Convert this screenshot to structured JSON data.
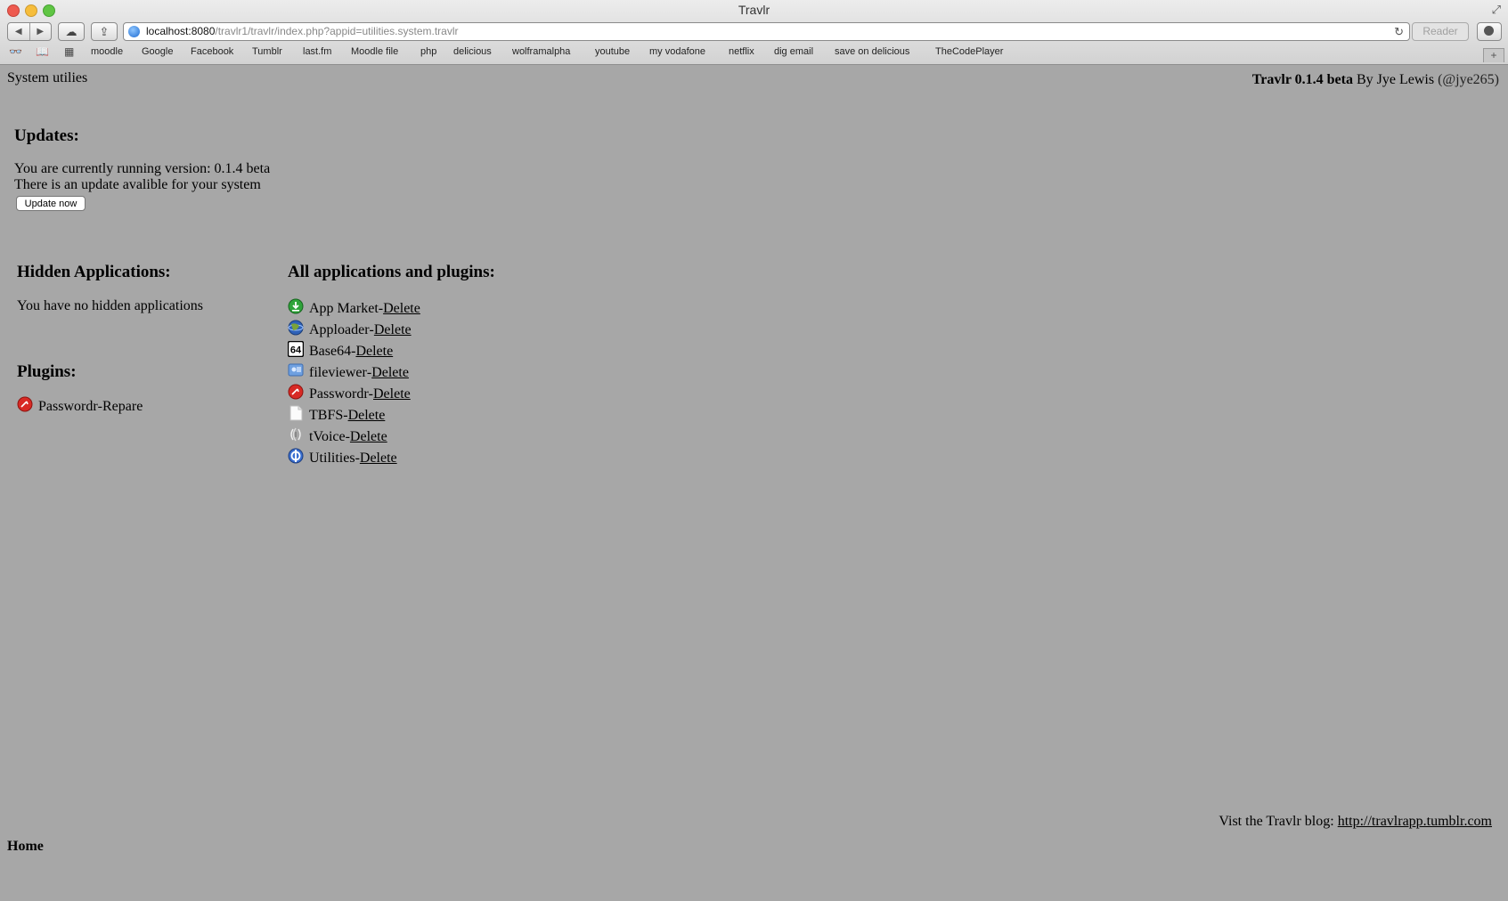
{
  "browser": {
    "window_title": "Travlr",
    "url_host": "localhost:8080",
    "url_path": "/travlr1/travlr/index.php?appid=utilities.system.travlr",
    "reader_label": "Reader",
    "bookmarks": [
      "moodle",
      "Google",
      "Facebook",
      "Tumblr",
      "last.fm",
      "Moodle file",
      "php",
      "delicious",
      "wolframalpha",
      "youtube",
      "my vodafone",
      "netflix",
      "dig email",
      "save on delicious",
      "TheCodePlayer"
    ]
  },
  "header": {
    "page_title": "System utilies",
    "app_name": "Travlr 0.1.4 beta",
    "by_text": " By Jye Lewis ",
    "handle": "(@jye265)"
  },
  "updates": {
    "title": "Updates:",
    "version_text": "You are currently running version: 0.1.4 beta",
    "available_text": "There is an update avalible for your system",
    "button_label": "Update now"
  },
  "hidden_apps": {
    "title": "Hidden Applications:",
    "text": "You have no hidden applications"
  },
  "plugins": {
    "title": "Plugins:",
    "items": [
      {
        "name": "Passwordr",
        "sep": " - ",
        "action": "Repare",
        "icon": "passwordr-icon"
      }
    ]
  },
  "all_apps": {
    "title": "All applications and plugins:",
    "items": [
      {
        "name": "App Market",
        "sep": " - ",
        "action": "Delete",
        "icon": "app-market-icon"
      },
      {
        "name": "Apploader",
        "sep": " - ",
        "action": "Delete",
        "icon": "apploader-icon"
      },
      {
        "name": "Base64",
        "sep": " - ",
        "action": "Delete",
        "icon": "base64-icon"
      },
      {
        "name": "fileviewer",
        "sep": " - ",
        "action": "Delete",
        "icon": "fileviewer-icon"
      },
      {
        "name": "Passwordr",
        "sep": " - ",
        "action": "Delete",
        "icon": "passwordr-icon"
      },
      {
        "name": "TBFS",
        "sep": " - ",
        "action": "Delete",
        "icon": "tbfs-icon"
      },
      {
        "name": "tVoice",
        "sep": " - ",
        "action": "Delete",
        "icon": "tvoice-icon"
      },
      {
        "name": "Utilities",
        "sep": " - ",
        "action": "Delete",
        "icon": "utilities-icon"
      }
    ]
  },
  "footer": {
    "blog_text": "Vist the Travlr blog: ",
    "blog_link": "http://travlrapp.tumblr.com",
    "home_label": "Home"
  }
}
